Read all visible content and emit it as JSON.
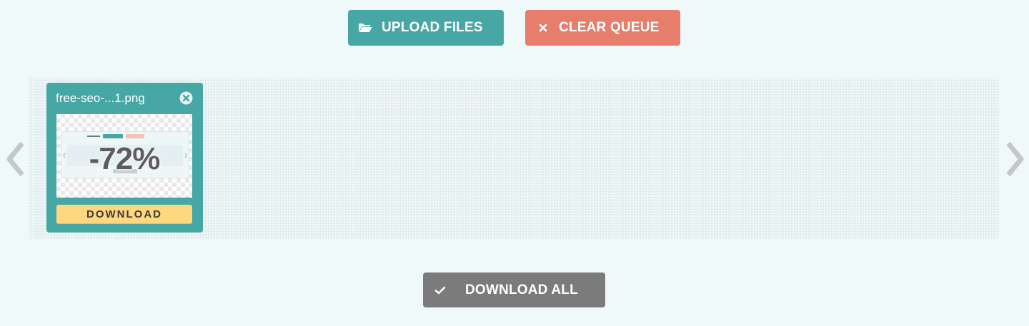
{
  "toolbar": {
    "upload_label": "UPLOAD FILES",
    "upload_icon": "folder-open-icon",
    "upload_color": "#47a7a5",
    "clear_label": "CLEAR QUEUE",
    "clear_icon": "close-icon",
    "clear_color": "#e77d6b"
  },
  "queue": {
    "prev_icon": "chevron-left-icon",
    "next_icon": "chevron-right-icon",
    "files": [
      {
        "name": "free-seo-...1.png",
        "saving": "-72%",
        "download_label": "DOWNLOAD",
        "remove_icon": "remove-circle-icon",
        "card_color": "#47a7a5",
        "download_color": "#fed77f"
      }
    ]
  },
  "footer": {
    "download_all_label": "DOWNLOAD ALL",
    "download_all_icon": "checkmark-icon",
    "download_all_color": "#7b7b7b"
  }
}
